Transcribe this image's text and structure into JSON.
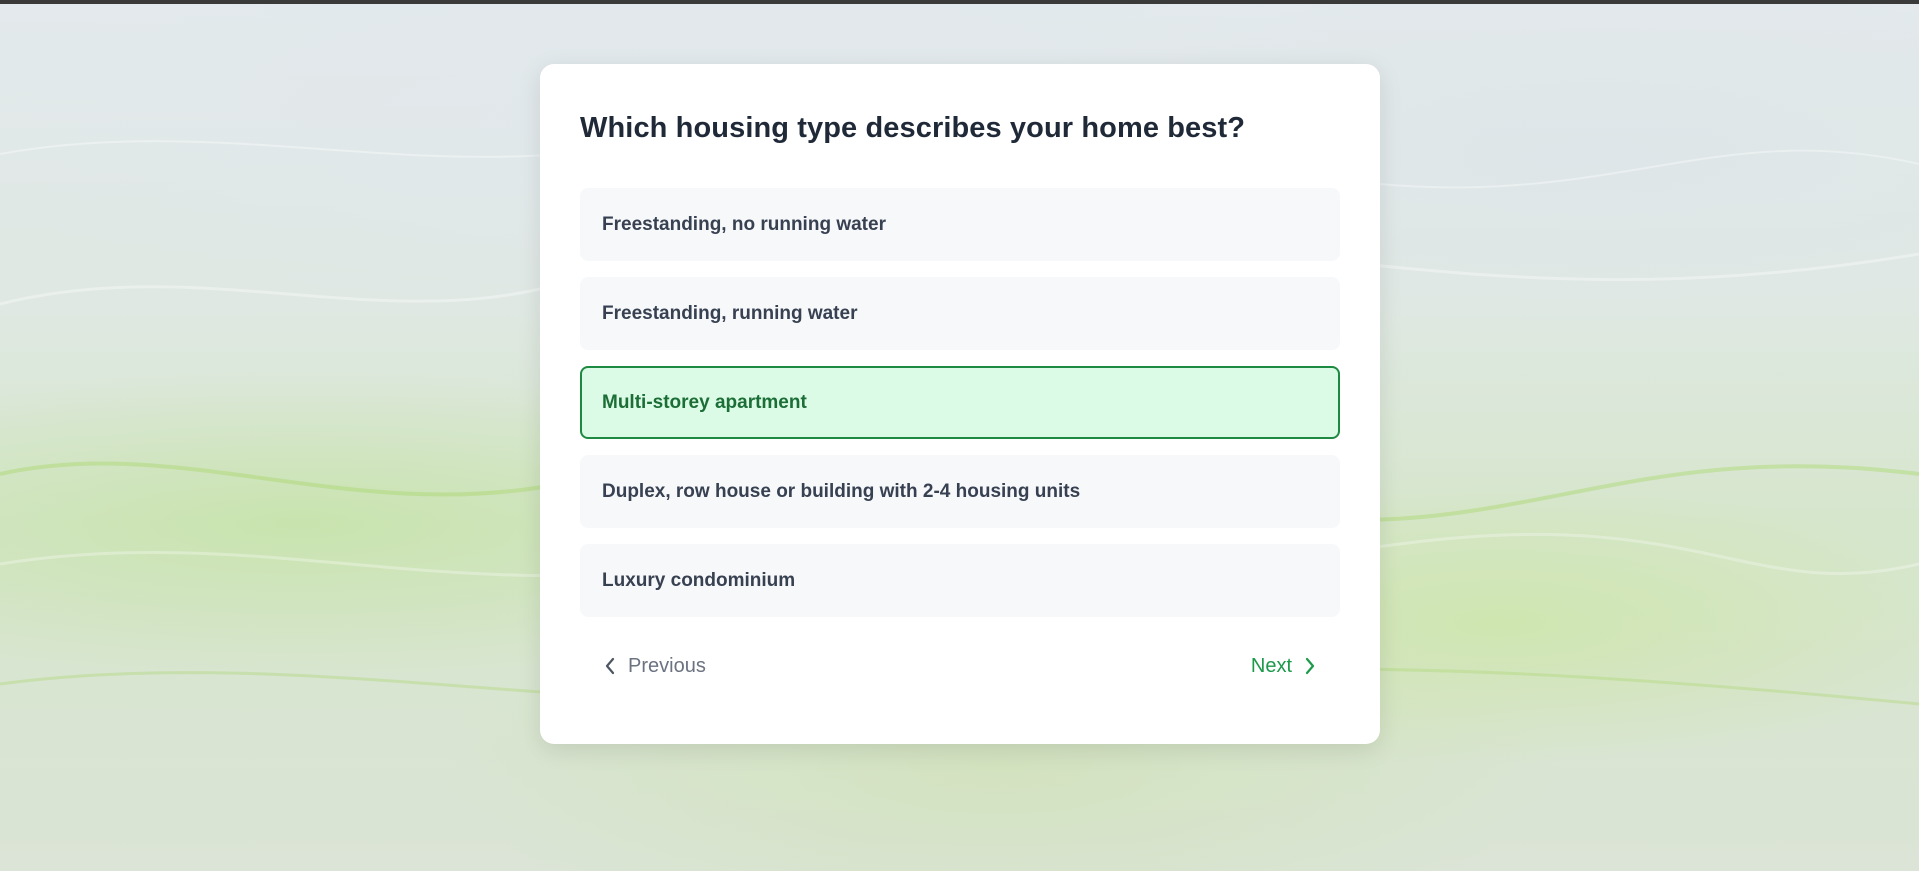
{
  "survey": {
    "question": "Which housing type describes your home best?",
    "options": [
      {
        "label": "Freestanding, no running water",
        "selected": false
      },
      {
        "label": "Freestanding, running water",
        "selected": false
      },
      {
        "label": "Multi-storey apartment",
        "selected": true
      },
      {
        "label": "Duplex, row house or building with 2-4 housing units",
        "selected": false
      },
      {
        "label": "Luxury condominium",
        "selected": false
      }
    ]
  },
  "navigation": {
    "previous_label": "Previous",
    "previous_icon": "chevron-left-icon",
    "next_label": "Next",
    "next_icon": "chevron-right-icon"
  },
  "colors": {
    "selected_border": "#1e8a41",
    "selected_background": "#dcfbe6",
    "next_accent": "#1c9a4a"
  }
}
